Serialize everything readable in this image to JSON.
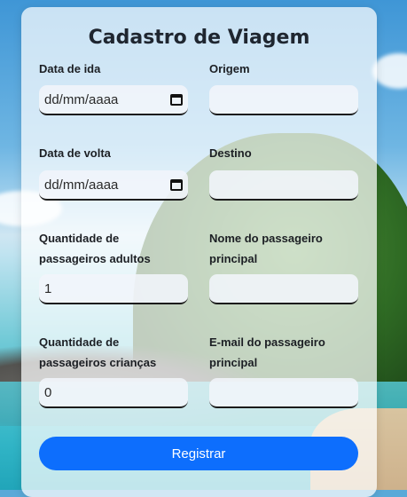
{
  "form": {
    "title": "Cadastro de Viagem",
    "fields": {
      "data_ida": {
        "label": "Data de ida",
        "value": "dd/mm/aaaa"
      },
      "origem": {
        "label": "Origem",
        "value": ""
      },
      "data_volta": {
        "label": "Data de volta",
        "value": "dd/mm/aaaa"
      },
      "destino": {
        "label": "Destino",
        "value": ""
      },
      "adultos": {
        "label_line1": "Quantidade de",
        "label_line2": "passageiros adultos",
        "value": "1"
      },
      "nome_passageiro": {
        "label_line1": "Nome do passageiro",
        "label_line2": "principal",
        "value": ""
      },
      "criancas": {
        "label_line1": "Quantidade de",
        "label_line2": "passageiros crianças",
        "value": "0"
      },
      "email_passageiro": {
        "label_line1": "E-mail do passageiro",
        "label_line2": "principal",
        "value": ""
      }
    },
    "submit_label": "Registrar"
  },
  "icons": {
    "date_picker": "calendar-icon"
  },
  "colors": {
    "button": "#0d6efd"
  }
}
